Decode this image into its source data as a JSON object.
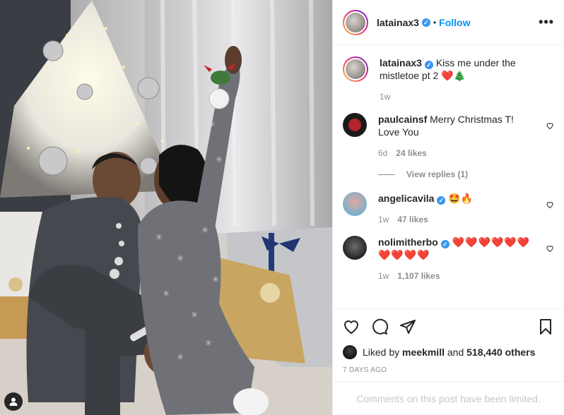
{
  "post": {
    "author": "latainax3",
    "follow_label": "Follow",
    "separator": "•",
    "more_label": "•••",
    "caption": "Kiss me under the mistletoe pt 2",
    "caption_emoji": "❤️🎄",
    "caption_time": "1w"
  },
  "comments": [
    {
      "user": "paulcainsf",
      "text": "Merry Christmas T! Love You",
      "time": "6d",
      "likes": "24 likes",
      "verified": false,
      "avatar_color": "#1a1a1a"
    },
    {
      "user": "angelicavila",
      "text": "🤩🔥",
      "time": "1w",
      "likes": "47 likes",
      "verified": true,
      "avatar_color": "#a7c5d6"
    },
    {
      "user": "nolimitherbo",
      "text": "❤️❤️❤️❤️❤️❤️❤️❤️❤️❤️",
      "time": "1w",
      "likes": "1,107 likes",
      "verified": true,
      "avatar_color": "#2e2e2e"
    }
  ],
  "replies_label": "View replies (1)",
  "likes_line": {
    "prefix": "Liked by",
    "liker": "meekmill",
    "and": "and",
    "others": "518,440 others"
  },
  "posted_ago": "7 DAYS AGO",
  "comments_limited": "Comments on this post have been limited.",
  "colors": {
    "link": "#0095f6",
    "verified": "#3897f0",
    "heart": "#ed4956",
    "muted": "#8e8e8e"
  },
  "icons": [
    "more-icon",
    "heart-icon",
    "comment-icon",
    "share-icon",
    "bookmark-icon",
    "verified-icon",
    "user-icon"
  ]
}
